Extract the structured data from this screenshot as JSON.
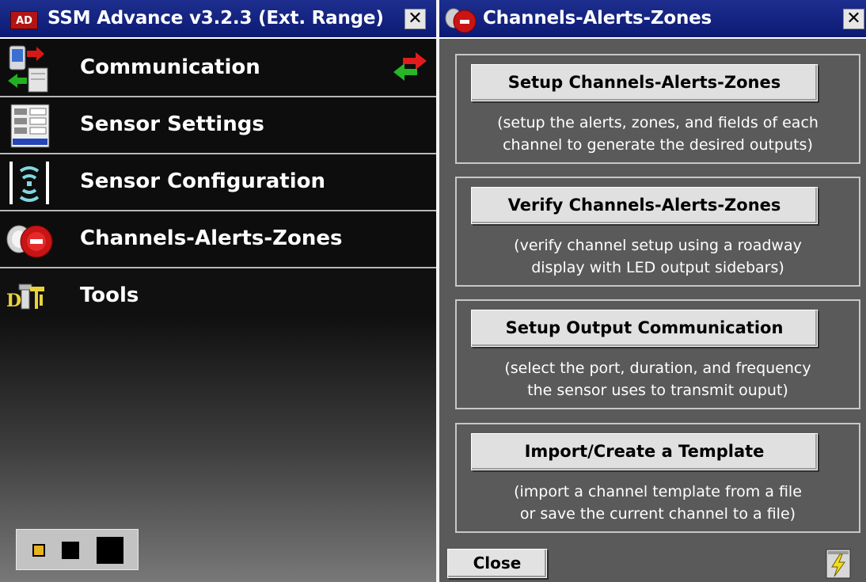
{
  "left_window": {
    "title": "SSM Advance v3.2.3 (Ext. Range)",
    "logo_text": "AD",
    "close_glyph": "✕",
    "menu": [
      {
        "label": "Communication",
        "icon": "communication-icon",
        "trailing_icon": "sync-arrows-icon"
      },
      {
        "label": "Sensor Settings",
        "icon": "sensor-settings-icon"
      },
      {
        "label": "Sensor Configuration",
        "icon": "sensor-configuration-icon"
      },
      {
        "label": "Channels-Alerts-Zones",
        "icon": "channels-alerts-zones-icon"
      },
      {
        "label": "Tools",
        "icon": "tools-icon"
      }
    ],
    "view_toggle": {
      "options": [
        "small",
        "medium",
        "large"
      ],
      "selected": "small",
      "selected_color": "#e8b321"
    }
  },
  "right_window": {
    "title": "Channels-Alerts-Zones",
    "close_glyph": "✕",
    "sections": [
      {
        "button": "Setup Channels-Alerts-Zones",
        "desc": [
          "(setup the alerts, zones, and fields of each",
          "channel to generate the desired outputs)"
        ]
      },
      {
        "button": "Verify Channels-Alerts-Zones",
        "desc": [
          "(verify channel setup using a roadway",
          "display with LED output sidebars)"
        ]
      },
      {
        "button": "Setup Output Communication",
        "desc": [
          "(select the port, duration, and frequency",
          "the sensor uses to transmit ouput)"
        ]
      },
      {
        "button": "Import/Create a Template",
        "desc": [
          "(import a channel template from a file",
          "or save the current channel to a file)"
        ]
      }
    ],
    "close_button": "Close",
    "power_icon": "power-status-icon"
  },
  "colors": {
    "titlebar": "#1a2b8a",
    "panel_gray": "#5a5a5a",
    "accent_red": "#d01818",
    "toggle_selected": "#e8b321"
  }
}
